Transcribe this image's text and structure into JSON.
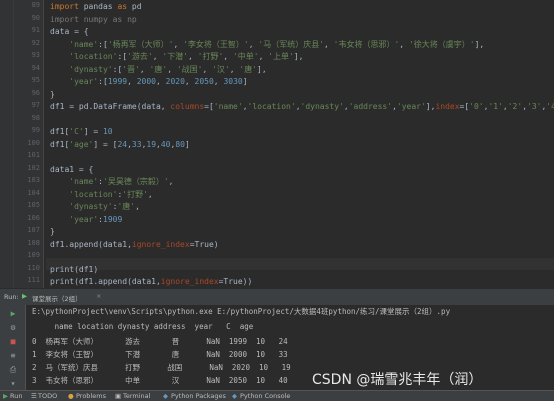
{
  "editor": {
    "line_numbers": [
      "89",
      "90",
      "91",
      "92",
      "93",
      "94",
      "95",
      "96",
      "97",
      "98",
      "99",
      "100",
      "101",
      "102",
      "103",
      "104",
      "105",
      "106",
      "107",
      "108",
      "109",
      "110",
      "111"
    ],
    "lines": [
      "import pandas as pd",
      "import numpy as np",
      "data = {",
      "    'name':['杨再军（大师）', '李女将（王智）', '马（军统）庆县', '韦女将（思邪）', '徐大将（虞宇）'],",
      "    'location':['游去', '下潜', '打野', '中单', '上单'],",
      "    'dynasty':['晋', '唐', '战国', '汉', '唐'],",
      "    'year':[1999, 2000, 2020, 2050, 3030]",
      "}",
      "df1 = pd.DataFrame(data, columns=['name','location','dynasty','address','year'],index=['0','1','2','3','4'])",
      "",
      "df1['C'] = 10",
      "df1['age'] = [24,33,19,40,80]",
      "",
      "data1 = {",
      "    'name':'吴昊德（宗毅）',",
      "    'location':'打野',",
      "    'dynasty':'唐',",
      "    'year':1909",
      "}",
      "df1.append(data1,ignore_index=True)",
      "",
      "print(df1)",
      "print(df1.append(data1,ignore_index=True))"
    ]
  },
  "run": {
    "tab_label": "Run:",
    "config_name": "课堂展示（2组）",
    "command": "E:\\pythonProject\\venv\\Scripts\\python.exe E:/pythonProject/大数据4班python/练习/课堂展示（2组）.py",
    "header_row": "     name location dynasty address  year   C  age",
    "rows": [
      "0  杨再军（大师）      游去       晋      NaN  1999  10   24",
      "1  李女将（王智）      下潜       唐      NaN  2000  10   33",
      "2  马（军统）庆县      打野      战国      NaN  2020  10   19",
      "3  韦女将（思邪）      中单       汉      NaN  2050  10   40"
    ]
  },
  "statusbar": {
    "items": [
      "Run",
      "TODO",
      "Problems",
      "Terminal",
      "Python Packages",
      "Python Console"
    ]
  },
  "watermark": "CSDN @瑞雪兆丰年（润）"
}
